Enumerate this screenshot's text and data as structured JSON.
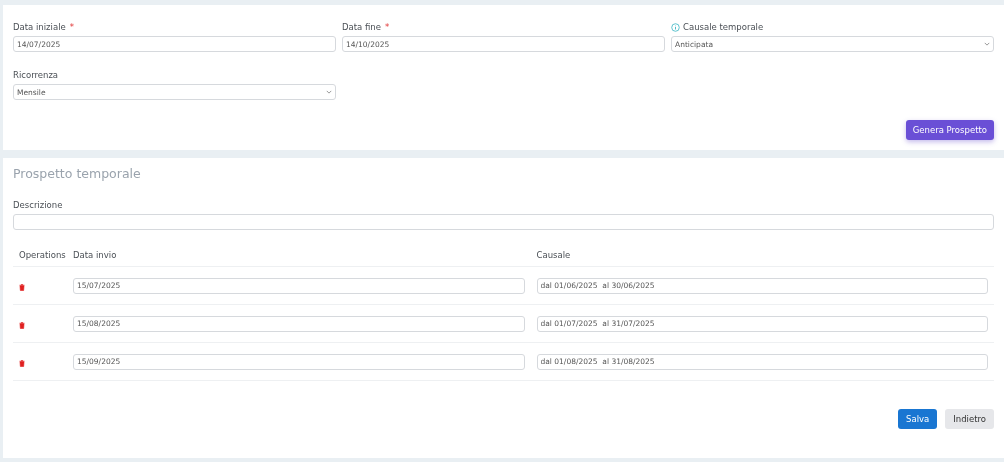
{
  "filters": [
    {
      "kind": "input",
      "label": "Data iniziale",
      "required_mark": "*",
      "value": "14/07/2025"
    },
    {
      "kind": "input",
      "label": "Data fine",
      "required_mark": "*",
      "value": "14/10/2025"
    },
    {
      "kind": "select",
      "label": "Causale temporale",
      "info": true,
      "value": "Anticipata"
    },
    {
      "kind": "select",
      "label": "Ricorrenza",
      "value": "Mensile"
    }
  ],
  "generate_button": "Genera Prospetto",
  "section_title": "Prospetto temporale",
  "description": {
    "label": "Descrizione"
  },
  "table": {
    "columns": [
      "Operations",
      "Data invio",
      "Causale"
    ],
    "rows": [
      {
        "date": "15/07/2025",
        "reason": "dal 01/06/2025  al 30/06/2025"
      },
      {
        "date": "15/08/2025",
        "reason": "dal 01/07/2025  al 31/07/2025"
      },
      {
        "date": "15/09/2025",
        "reason": "dal 01/08/2025  al 31/08/2025"
      }
    ]
  },
  "buttons": [
    {
      "label": "Salva",
      "kind": "primary"
    },
    {
      "label": "Indietro",
      "kind": "secondary"
    }
  ]
}
